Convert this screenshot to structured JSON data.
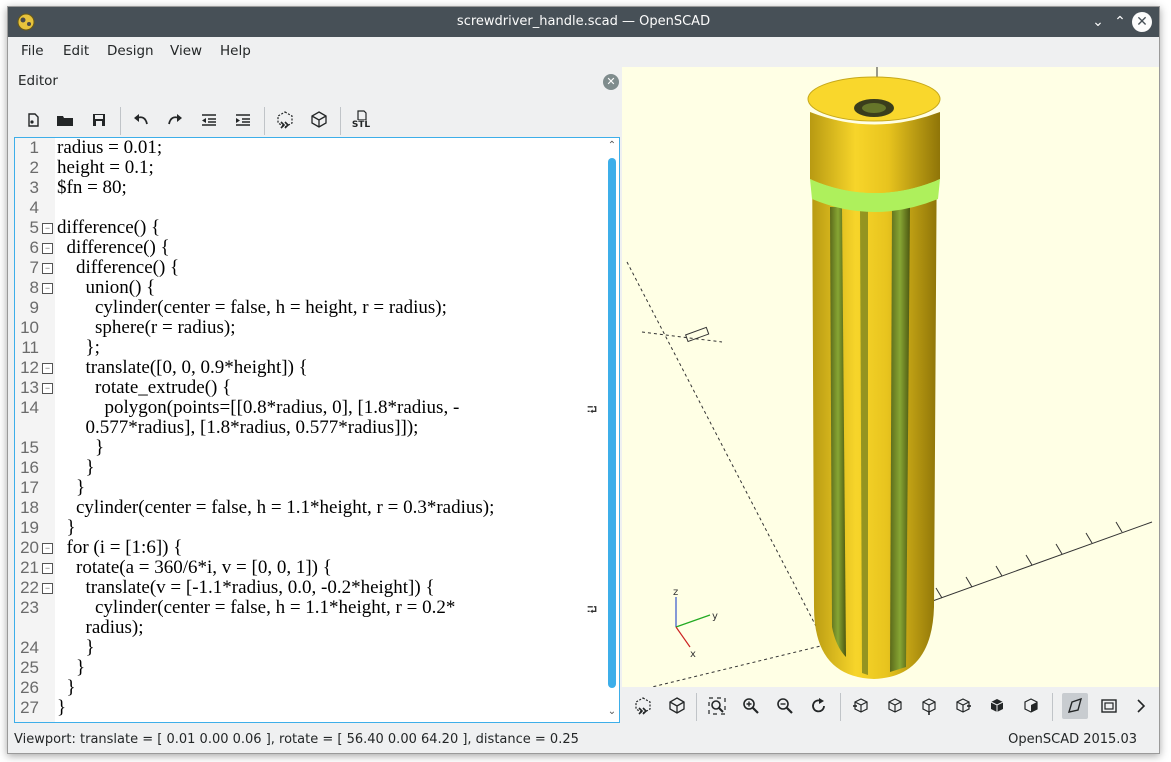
{
  "window": {
    "title": "screwdriver_handle.scad — OpenSCAD",
    "controls": [
      "minimize-icon",
      "maximize-icon",
      "close-icon"
    ]
  },
  "menu": [
    "File",
    "Edit",
    "Design",
    "View",
    "Help"
  ],
  "editor": {
    "header": "Editor",
    "toolbar": [
      "new-file-icon",
      "open-file-icon",
      "save-icon",
      "undo-icon",
      "redo-icon",
      "unindent-icon",
      "indent-icon",
      "preview-icon",
      "render-icon",
      "export-stl-icon"
    ],
    "export_label": "STL",
    "lines": [
      {
        "n": "1",
        "text": "radius = 0.01;",
        "fold": false
      },
      {
        "n": "2",
        "text": "height = 0.1;",
        "fold": false
      },
      {
        "n": "3",
        "text": "$fn = 80;",
        "fold": false
      },
      {
        "n": "4",
        "text": "",
        "fold": false
      },
      {
        "n": "5",
        "text": "difference() {",
        "fold": true
      },
      {
        "n": "6",
        "text": "  difference() {",
        "fold": true
      },
      {
        "n": "7",
        "text": "    difference() {",
        "fold": true
      },
      {
        "n": "8",
        "text": "      union() {",
        "fold": true
      },
      {
        "n": "9",
        "text": "        cylinder(center = false, h = height, r = radius);",
        "fold": false
      },
      {
        "n": "10",
        "text": "        sphere(r = radius);",
        "fold": false
      },
      {
        "n": "11",
        "text": "      };",
        "fold": false
      },
      {
        "n": "12",
        "text": "      translate([0, 0, 0.9*height]) {",
        "fold": true
      },
      {
        "n": "13",
        "text": "        rotate_extrude() {",
        "fold": true
      },
      {
        "n": "14",
        "text": "          polygon(points=[[0.8*radius, 0], [1.8*radius, -",
        "fold": false,
        "wrap": true
      },
      {
        "n": "",
        "text": "      0.577*radius], [1.8*radius, 0.577*radius]]);",
        "fold": false
      },
      {
        "n": "15",
        "text": "        }",
        "fold": false
      },
      {
        "n": "16",
        "text": "      }",
        "fold": false
      },
      {
        "n": "17",
        "text": "    }",
        "fold": false
      },
      {
        "n": "18",
        "text": "    cylinder(center = false, h = 1.1*height, r = 0.3*radius);",
        "fold": false
      },
      {
        "n": "19",
        "text": "  }",
        "fold": false
      },
      {
        "n": "20",
        "text": "  for (i = [1:6]) {",
        "fold": true
      },
      {
        "n": "21",
        "text": "    rotate(a = 360/6*i, v = [0, 0, 1]) {",
        "fold": true
      },
      {
        "n": "22",
        "text": "      translate(v = [-1.1*radius, 0.0, -0.2*height]) {",
        "fold": true
      },
      {
        "n": "23",
        "text": "        cylinder(center = false, h = 1.1*height, r = 0.2*",
        "fold": false,
        "wrap": true
      },
      {
        "n": "",
        "text": "      radius);",
        "fold": false
      },
      {
        "n": "24",
        "text": "      }",
        "fold": false
      },
      {
        "n": "25",
        "text": "    }",
        "fold": false
      },
      {
        "n": "26",
        "text": "  }",
        "fold": false
      },
      {
        "n": "27",
        "text": "}",
        "fold": false
      }
    ]
  },
  "viewport": {
    "background": "#ffffe5",
    "model_color": "#f9d72c",
    "groove_color": "#aef05c",
    "axis_labels": {
      "x": "x",
      "y": "y",
      "z": "z"
    },
    "toolbar": [
      "preview-icon",
      "render-icon",
      "zoom-all-icon",
      "zoom-in-icon",
      "zoom-out-icon",
      "reset-view-icon",
      "view-right-icon",
      "view-top-icon",
      "view-bottom-icon",
      "view-left-icon",
      "view-front-icon",
      "view-back-icon",
      "perspective-icon",
      "orthogonal-icon",
      "more-icon"
    ]
  },
  "status": {
    "left": "Viewport: translate = [ 0.01 0.00 0.06 ], rotate = [ 56.40 0.00 64.20 ], distance = 0.25",
    "right": "OpenSCAD 2015.03"
  }
}
